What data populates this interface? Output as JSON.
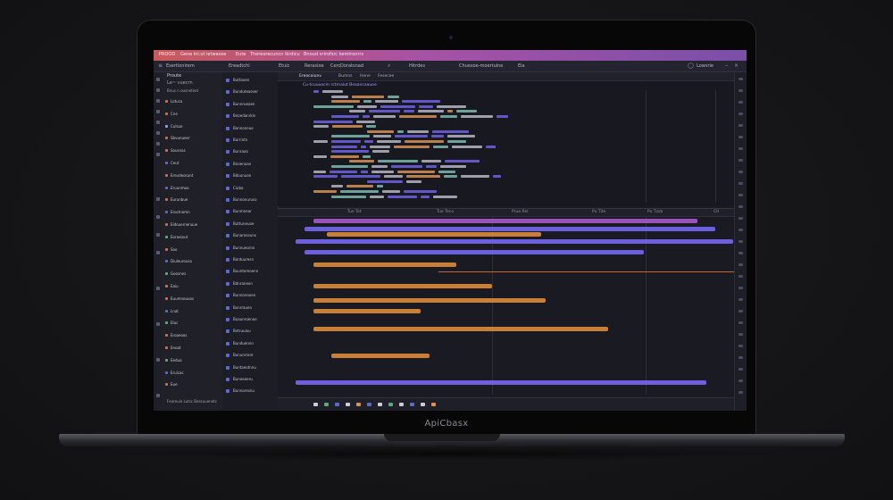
{
  "device": {
    "brand_label": "ApiCbasx"
  },
  "titlebar": {
    "items": [
      "PROOD",
      "Gene ini.ut  ietwaose",
      "Eute",
      "Thereorecuncn ikrdicu",
      "Bnoud vrirofsrc kemtronrrs"
    ]
  },
  "menubar": {
    "items": [
      "Esertlonirem",
      "Ereadtchi",
      "Etuic",
      "Rerasioe",
      "Cerc",
      "Doratsnad",
      "Hitrdes",
      "Chuexoe-moertuine",
      "Ela"
    ],
    "right_label": "Lowsrie"
  },
  "explorer": {
    "header": "Proute",
    "subheader": "Le~ vuecrn",
    "filter": "Bnuc n ousneteat",
    "items": [
      {
        "label": "Lotuca",
        "color": "#d96a4a"
      },
      {
        "label": "Cne",
        "color": "#d96a4a"
      },
      {
        "label": "Culsue",
        "color": "#8aa0ff"
      },
      {
        "label": "Sbvunueer",
        "color": "#d96a4a"
      },
      {
        "label": "Sousnas",
        "color": "#d96a4a"
      },
      {
        "label": "Ceut",
        "color": "#5b69d8"
      },
      {
        "label": "Ereudeosunt",
        "color": "#d96a4a"
      },
      {
        "label": "Eruunmoo",
        "color": "#5b69d8"
      },
      {
        "label": "Eurunbue",
        "color": "#d96a4a"
      },
      {
        "label": "Eroctnomn",
        "color": "#5b69d8"
      },
      {
        "label": "Eldouernenuue",
        "color": "#d96a4a"
      },
      {
        "label": "Eoraeiout",
        "color": "#4fb36f"
      },
      {
        "label": "Soo",
        "color": "#d96a4a"
      },
      {
        "label": "Diuleurouso",
        "color": "#5b69d8"
      },
      {
        "label": "Goosnes",
        "color": "#4fb36f"
      },
      {
        "label": "Eaiu",
        "color": "#d96a4a"
      },
      {
        "label": "Euumneuuos",
        "color": "#d96a4a"
      },
      {
        "label": "Lnat",
        "color": "#5b69d8"
      },
      {
        "label": "Eluc",
        "color": "#4fb36f"
      },
      {
        "label": "Eroaeoos",
        "color": "#d96a4a"
      },
      {
        "label": "Enoat",
        "color": "#d96a4a"
      },
      {
        "label": "Eedua",
        "color": "#4fb36f"
      },
      {
        "label": "Eruicac",
        "color": "#5b69d8"
      },
      {
        "label": "Eue",
        "color": "#d96a4a"
      }
    ],
    "footer": "Fooreuie  Lutsc  Bessuuenotc"
  },
  "files": {
    "items": [
      "Buttaoen",
      "Bunduteaeser",
      "Bunnrueaen",
      "Bnoedanrkin",
      "Bannoneue",
      "Burrintn",
      "Bunraoo",
      "Bnoenuan",
      "Bdounueo",
      "Ciubo",
      "Bunnonuruso",
      "Bunmneor",
      "Buttuneuoe",
      "Bunaroseuns",
      "Bunnueornn",
      "Bontuuresn",
      "Buuntomoenn",
      "Bdnraneon",
      "Bunnonooen",
      "Bunrrauen",
      "Buaunroenoe",
      "Bntruuiou",
      "Bunduennn",
      "Bununrrore",
      "Buntaeotnnu",
      "Bunoeoeru",
      "Bunnoresnu"
    ]
  },
  "editor_top": {
    "tabs": [
      "Ereocoiunv",
      "Bumns",
      "Hene",
      "Fesecee"
    ],
    "title": "Cu-tcuuuocm  rctrnaiut  Beaancaauoe"
  },
  "editor_bottom": {
    "ruler": [
      "Tue  Tet",
      "Tue  Teco",
      "Pruo  Rel",
      "Pu  Tite",
      "Pu  Tzsb",
      "Ctl"
    ]
  },
  "colors": {
    "title_gradient_start": "#c85a5e",
    "title_gradient_end": "#7a4fa8",
    "bar_orange": "#e9903a",
    "bar_purple": "#b05bd6",
    "code_purple": "#7b6cff",
    "code_orange": "#f0a25b"
  }
}
